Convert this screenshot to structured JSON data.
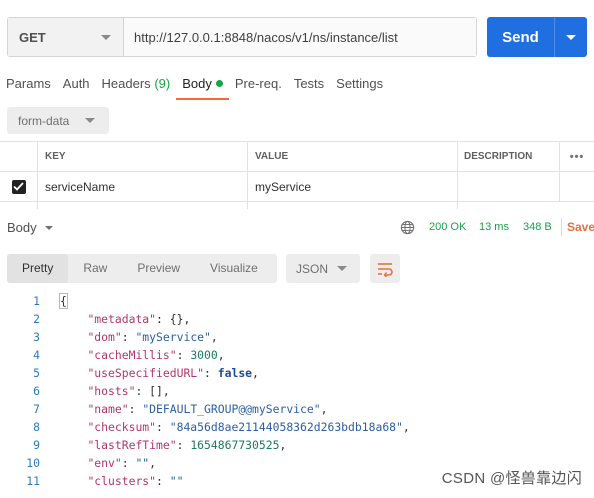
{
  "request": {
    "method": "GET",
    "url": "http://127.0.0.1:8848/nacos/v1/ns/instance/list",
    "send_label": "Send"
  },
  "tabs": [
    {
      "label": "Params"
    },
    {
      "label": "Auth"
    },
    {
      "label": "Headers",
      "count": "(9)"
    },
    {
      "label": "Body",
      "active": true
    },
    {
      "label": "Pre-req."
    },
    {
      "label": "Tests"
    },
    {
      "label": "Settings"
    }
  ],
  "body_type": "form-data",
  "params_table": {
    "headers": [
      "KEY",
      "VALUE",
      "DESCRIPTION"
    ],
    "more": "•••",
    "rows": [
      {
        "checked": true,
        "key": "serviceName",
        "value": "myService",
        "description": ""
      }
    ]
  },
  "response": {
    "label": "Body",
    "status": "200 OK",
    "time": "13 ms",
    "size": "348 B",
    "save_label": "Save",
    "view_tabs": [
      "Pretty",
      "Raw",
      "Preview",
      "Visualize"
    ],
    "active_view": "Pretty",
    "format": "JSON"
  },
  "code_lines": [
    {
      "n": "1",
      "parts": [
        [
          "p",
          "{"
        ]
      ]
    },
    {
      "n": "2",
      "parts": [
        [
          "p",
          "    "
        ],
        [
          "k",
          "\"metadata\""
        ],
        [
          "p",
          ": {},"
        ]
      ]
    },
    {
      "n": "3",
      "parts": [
        [
          "p",
          "    "
        ],
        [
          "k",
          "\"dom\""
        ],
        [
          "p",
          ": "
        ],
        [
          "s",
          "\"myService\""
        ],
        [
          "p",
          ","
        ]
      ]
    },
    {
      "n": "4",
      "parts": [
        [
          "p",
          "    "
        ],
        [
          "k",
          "\"cacheMillis\""
        ],
        [
          "p",
          ": "
        ],
        [
          "n",
          "3000"
        ],
        [
          "p",
          ","
        ]
      ]
    },
    {
      "n": "5",
      "parts": [
        [
          "p",
          "    "
        ],
        [
          "k",
          "\"useSpecifiedURL\""
        ],
        [
          "p",
          ": "
        ],
        [
          "b",
          "false"
        ],
        [
          "p",
          ","
        ]
      ]
    },
    {
      "n": "6",
      "parts": [
        [
          "p",
          "    "
        ],
        [
          "k",
          "\"hosts\""
        ],
        [
          "p",
          ": [],"
        ]
      ]
    },
    {
      "n": "7",
      "parts": [
        [
          "p",
          "    "
        ],
        [
          "k",
          "\"name\""
        ],
        [
          "p",
          ": "
        ],
        [
          "s",
          "\"DEFAULT_GROUP@@myService\""
        ],
        [
          "p",
          ","
        ]
      ]
    },
    {
      "n": "8",
      "parts": [
        [
          "p",
          "    "
        ],
        [
          "k",
          "\"checksum\""
        ],
        [
          "p",
          ": "
        ],
        [
          "s",
          "\"84a56d8ae21144058362d263bdb18a68\""
        ],
        [
          "p",
          ","
        ]
      ]
    },
    {
      "n": "9",
      "parts": [
        [
          "p",
          "    "
        ],
        [
          "k",
          "\"lastRefTime\""
        ],
        [
          "p",
          ": "
        ],
        [
          "n",
          "1654867730525"
        ],
        [
          "p",
          ","
        ]
      ]
    },
    {
      "n": "10",
      "parts": [
        [
          "p",
          "    "
        ],
        [
          "k",
          "\"env\""
        ],
        [
          "p",
          ": "
        ],
        [
          "s",
          "\"\""
        ],
        [
          "p",
          ","
        ]
      ]
    },
    {
      "n": "11",
      "parts": [
        [
          "p",
          "    "
        ],
        [
          "k",
          "\"clusters\""
        ],
        [
          "p",
          ": "
        ],
        [
          "s",
          "\"\""
        ]
      ]
    }
  ],
  "watermark": "CSDN @怪兽靠边闪",
  "colors": {
    "send": "#1f6fe0",
    "status_ok": "#1aa34a",
    "active_tab": "#f26b3a",
    "save": "#e4713d",
    "json_key": "#b5366a",
    "json_string": "#2b5ea7",
    "json_number": "#1d7a5f"
  }
}
